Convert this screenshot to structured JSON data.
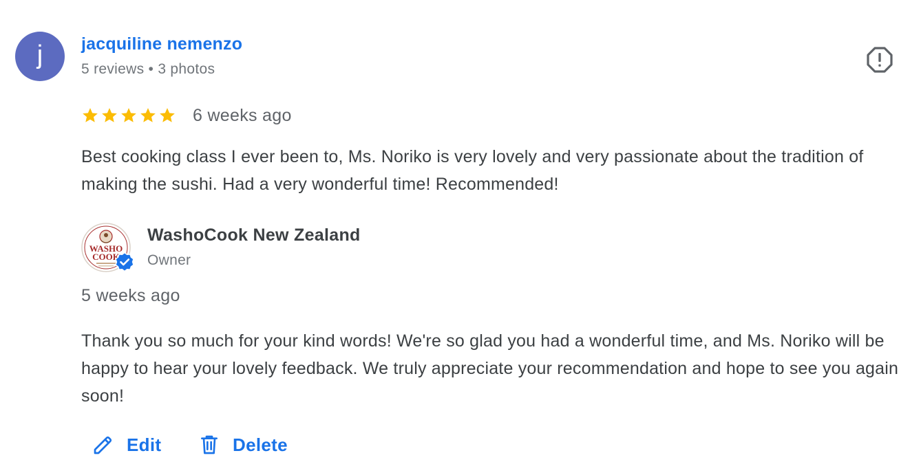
{
  "review": {
    "reviewer": {
      "initial": "j",
      "name": "jacquiline nemenzo",
      "meta": "5 reviews • 3 photos",
      "avatar_color": "#5c6bc0"
    },
    "rating": 5,
    "rating_max": 5,
    "date": "6 weeks ago",
    "text": "Best cooking class I ever been to, Ms. Noriko is very lovely and very passionate about the tradition of making the sushi. Had a very wonderful time! Recommended!",
    "flag_icon": "report-flag-icon"
  },
  "owner_reply": {
    "name": "WashoCook New Zealand",
    "role": "Owner",
    "logo_text_top": "WASHO",
    "logo_text_bottom": "COOK",
    "date": "5 weeks ago",
    "text": "Thank you so much for your kind words! We're so glad you had a wonderful time, and Ms. Noriko will be happy to hear your lovely feedback. We truly appreciate your recommendation and hope to see you again soon!",
    "verified_icon": "verified-badge-icon"
  },
  "actions": {
    "edit_label": "Edit",
    "delete_label": "Delete"
  },
  "colors": {
    "link_blue": "#1a73e8",
    "star_gold": "#fbbc04",
    "text_primary": "#3c4043",
    "text_secondary": "#70757a",
    "logo_red": "#a52a2a"
  }
}
